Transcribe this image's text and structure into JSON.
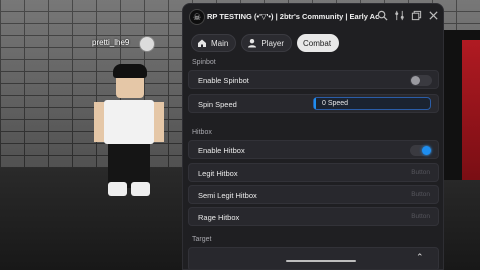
{
  "scene": {
    "player_name": "pretti_lhe9"
  },
  "window": {
    "logo_icon": "skull-logo-icon",
    "title": "RP TESTING (•'▽'•) | 2btr's Community | Early Access",
    "icons": [
      "search-icon",
      "settings-sliders-icon",
      "restore-window-icon",
      "close-icon"
    ]
  },
  "tabs": [
    {
      "label": "Main",
      "icon": "home-icon"
    },
    {
      "label": "Player",
      "icon": "user-icon"
    },
    {
      "label": "Combat",
      "icon": "",
      "active": true
    }
  ],
  "spinbot": {
    "section": "Spinbot",
    "enable_label": "Enable Spinbot",
    "enable_on": false,
    "speed_label": "Spin Speed",
    "speed_value": "0 Speed"
  },
  "hitbox": {
    "section": "Hitbox",
    "enable_label": "Enable Hitbox",
    "enable_on": true,
    "legit_label": "Legit Hitbox",
    "semi_label": "Semi Legit Hitbox",
    "rage_label": "Rage Hitbox",
    "button_hint": "Button"
  },
  "target": {
    "section": "Target"
  },
  "colors": {
    "accent": "#1e8ef0",
    "panel": "#1f1f22",
    "row": "#28282d"
  }
}
